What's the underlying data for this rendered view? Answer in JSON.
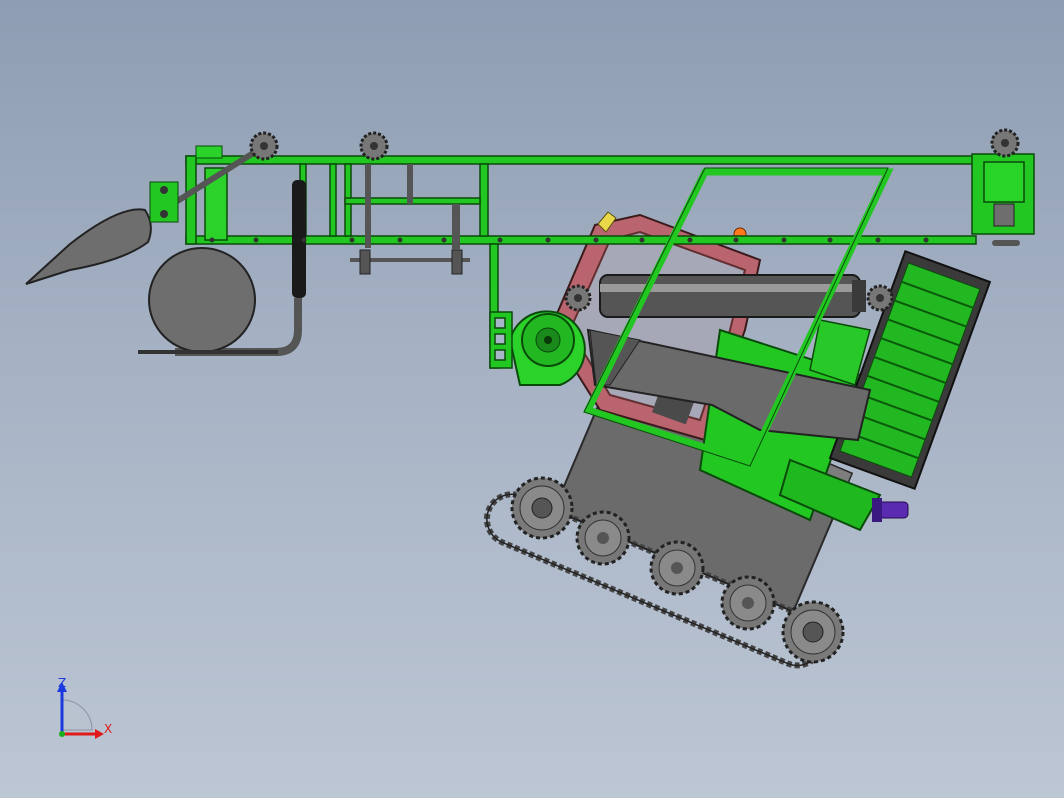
{
  "viewport": {
    "background_top": "#8e9db3",
    "background_bottom": "#bcc6d4"
  },
  "model": {
    "frame_color": "#22c722",
    "frame_dark": "#128a12",
    "body_gray": "#6a6a6a",
    "steel": "#8e8e8e",
    "cab_red": "#b86068",
    "accent_purple": "#5a2ab0",
    "accent_orange": "#ff7a1a"
  },
  "triad": {
    "z_label": "Z",
    "x_label": "X",
    "z_color": "#1a3adf",
    "x_color": "#e01a1a",
    "y_color": "#1ab01a"
  }
}
